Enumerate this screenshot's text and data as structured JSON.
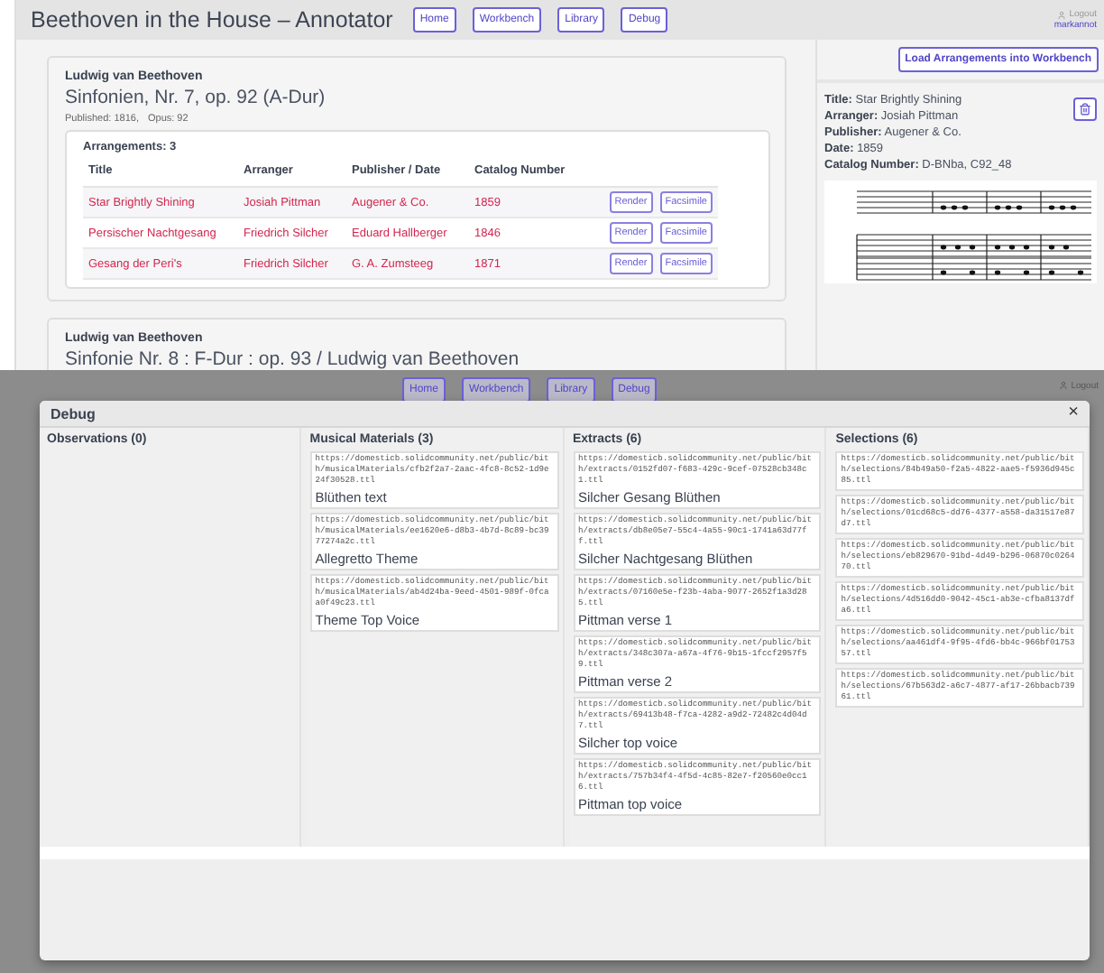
{
  "app": {
    "title": "Beethoven in the House – Annotator",
    "nav": [
      {
        "label": "Home"
      },
      {
        "label": "Workbench"
      },
      {
        "label": "Library"
      },
      {
        "label": "Debug"
      }
    ],
    "user": {
      "action": "Logout",
      "name": "markannot"
    }
  },
  "works": [
    {
      "composer": "Ludwig van Beethoven",
      "title": "Sinfonien, Nr. 7, op. 92 (A-Dur)",
      "published": "Published: 1816,",
      "opus": "Opus: 92",
      "arrangements_heading": "Arrangements: 3",
      "columns": [
        "Title",
        "Arranger",
        "Publisher / Date",
        "Catalog Number"
      ],
      "rows": [
        {
          "title": "Star Brightly Shining",
          "arranger": "Josiah Pittman",
          "publisher": "Augener & Co.",
          "date": "1859",
          "buttons": [
            "Render",
            "Facsimile"
          ]
        },
        {
          "title": "Persischer Nachtgesang",
          "arranger": "Friedrich Silcher",
          "publisher": "Eduard Hallberger",
          "date": "1846",
          "buttons": [
            "Render",
            "Facsimile"
          ]
        },
        {
          "title": "Gesang der Peri's",
          "arranger": "Friedrich Silcher",
          "publisher": "G. A. Zumsteeg",
          "date": "1871",
          "buttons": [
            "Render",
            "Facsimile"
          ]
        }
      ]
    },
    {
      "composer": "Ludwig van Beethoven",
      "title": "Sinfonie Nr. 8 : F-Dur : op. 93 / Ludwig van Beethoven"
    }
  ],
  "detail": {
    "load_button": "Load Arrangements into Workbench",
    "fields": [
      "**Title:** Star Brightly Shining",
      "**Arranger:** Josiah Pittman",
      "**Publisher:** Augener & Co.",
      "**Date:** 1859",
      "**Catalog Number:** D-BNba, C92_48"
    ],
    "score": {
      "kind": "picture"
    }
  },
  "debug_screen": {
    "nav": [
      {
        "label": "Home"
      },
      {
        "label": "Workbench"
      },
      {
        "label": "Library"
      },
      {
        "label": "Debug"
      }
    ],
    "user": {
      "action": "Logout"
    },
    "dialog": {
      "title": "Debug",
      "close": "×",
      "columns": [
        {
          "heading": "Observations (0)"
        },
        {
          "heading": "Musical Materials (3)",
          "items": [
            {
              "url": "https://domesticb.solidcommunity.net/public/bith/musicalMaterials/cfb2f2a7-2aac-4fc8-8c52-1d9e24f30528.ttl",
              "label": "Blüthen text"
            },
            {
              "url": "https://domesticb.solidcommunity.net/public/bith/musicalMaterials/ee1620e6-d8b3-4b7d-8c89-bc3977274a2c.ttl",
              "label": "Allegretto Theme"
            },
            {
              "url": "https://domesticb.solidcommunity.net/public/bith/musicalMaterials/ab4d24ba-9eed-4501-989f-0fcaa0f49c23.ttl",
              "label": "Theme Top Voice"
            }
          ]
        },
        {
          "heading": "Extracts (6)",
          "items": [
            {
              "url": "https://domesticb.solidcommunity.net/public/bith/extracts/0152fd07-f683-429c-9cef-07528cb348c1.ttl",
              "label": "Silcher Gesang Blüthen"
            },
            {
              "url": "https://domesticb.solidcommunity.net/public/bith/extracts/db8e05e7-55c4-4a55-90c1-1741a63d77ff.ttl",
              "label": "Silcher Nachtgesang Blüthen"
            },
            {
              "url": "https://domesticb.solidcommunity.net/public/bith/extracts/07160e5e-f23b-4aba-9077-2652f1a3d285.ttl",
              "label": "Pittman verse 1"
            },
            {
              "url": "https://domesticb.solidcommunity.net/public/bith/extracts/348c307a-a67a-4f76-9b15-1fccf2957f59.ttl",
              "label": "Pittman verse 2"
            },
            {
              "url": "https://domesticb.solidcommunity.net/public/bith/extracts/69413b48-f7ca-4282-a9d2-72482c4d04d7.ttl",
              "label": "Silcher top voice"
            },
            {
              "url": "https://domesticb.solidcommunity.net/public/bith/extracts/757b34f4-4f5d-4c85-82e7-f20560e0cc16.ttl",
              "label": "Pittman top voice"
            }
          ]
        },
        {
          "heading": "Selections (6)",
          "items": [
            {
              "url": "https://domesticb.solidcommunity.net/public/bith/selections/84b49a50-f2a5-4822-aae5-f5936d945c85.ttl"
            },
            {
              "url": "https://domesticb.solidcommunity.net/public/bith/selections/01cd68c5-dd76-4377-a558-da31517e87d7.ttl"
            },
            {
              "url": "https://domesticb.solidcommunity.net/public/bith/selections/eb829670-91bd-4d49-b296-06870c026470.ttl"
            },
            {
              "url": "https://domesticb.solidcommunity.net/public/bith/selections/4d516dd0-9042-45c1-ab3e-cfba8137dfa6.ttl"
            },
            {
              "url": "https://domesticb.solidcommunity.net/public/bith/selections/aa461df4-9f95-4fd6-bb4c-966bf0175357.ttl"
            },
            {
              "url": "https://domesticb.solidcommunity.net/public/bith/selections/67b563d2-a6c7-4877-af17-26bbacb73961.ttl"
            }
          ]
        }
      ]
    }
  }
}
